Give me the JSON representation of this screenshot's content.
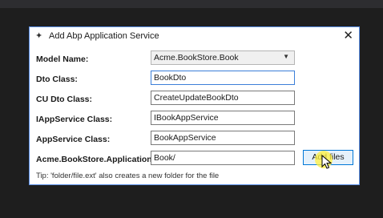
{
  "dialog": {
    "title": "Add Abp Application Service",
    "close_glyph": "✕",
    "title_icon": "✦"
  },
  "form": {
    "model_name_label": "Model Name:",
    "model_name_value": "Acme.BookStore.Book",
    "dto_class_label": "Dto Class:",
    "dto_class_value": "BookDto",
    "cu_dto_class_label": "CU Dto Class:",
    "cu_dto_class_value": "CreateUpdateBookDto",
    "iappservice_label": "IAppService Class:",
    "iappservice_value": "IBookAppService",
    "appservice_label": "AppService Class:",
    "appservice_value": "BookAppService",
    "folder_label": "Acme.BookStore.Application/",
    "folder_value": "Book/"
  },
  "buttons": {
    "add_files": "Add files"
  },
  "tip": "Tip: 'folder/file.ext' also creates a new folder for the file",
  "icons": {
    "dropdown": "chevron-down-icon",
    "close": "close-icon",
    "title": "wand-icon"
  },
  "colors": {
    "accent": "#0078d7",
    "background": "#1e1e1e"
  }
}
